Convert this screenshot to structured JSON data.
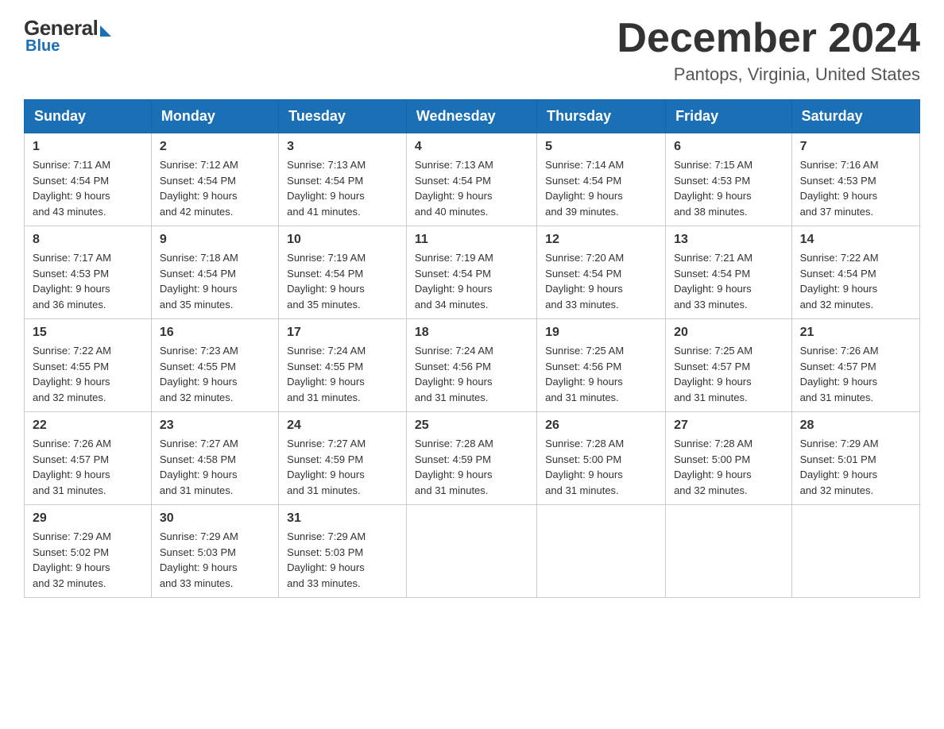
{
  "header": {
    "logo_general": "General",
    "logo_blue": "Blue",
    "month_title": "December 2024",
    "location": "Pantops, Virginia, United States"
  },
  "days_of_week": [
    "Sunday",
    "Monday",
    "Tuesday",
    "Wednesday",
    "Thursday",
    "Friday",
    "Saturday"
  ],
  "weeks": [
    [
      {
        "day": "1",
        "sunrise": "7:11 AM",
        "sunset": "4:54 PM",
        "daylight": "9 hours and 43 minutes."
      },
      {
        "day": "2",
        "sunrise": "7:12 AM",
        "sunset": "4:54 PM",
        "daylight": "9 hours and 42 minutes."
      },
      {
        "day": "3",
        "sunrise": "7:13 AM",
        "sunset": "4:54 PM",
        "daylight": "9 hours and 41 minutes."
      },
      {
        "day": "4",
        "sunrise": "7:13 AM",
        "sunset": "4:54 PM",
        "daylight": "9 hours and 40 minutes."
      },
      {
        "day": "5",
        "sunrise": "7:14 AM",
        "sunset": "4:54 PM",
        "daylight": "9 hours and 39 minutes."
      },
      {
        "day": "6",
        "sunrise": "7:15 AM",
        "sunset": "4:53 PM",
        "daylight": "9 hours and 38 minutes."
      },
      {
        "day": "7",
        "sunrise": "7:16 AM",
        "sunset": "4:53 PM",
        "daylight": "9 hours and 37 minutes."
      }
    ],
    [
      {
        "day": "8",
        "sunrise": "7:17 AM",
        "sunset": "4:53 PM",
        "daylight": "9 hours and 36 minutes."
      },
      {
        "day": "9",
        "sunrise": "7:18 AM",
        "sunset": "4:54 PM",
        "daylight": "9 hours and 35 minutes."
      },
      {
        "day": "10",
        "sunrise": "7:19 AM",
        "sunset": "4:54 PM",
        "daylight": "9 hours and 35 minutes."
      },
      {
        "day": "11",
        "sunrise": "7:19 AM",
        "sunset": "4:54 PM",
        "daylight": "9 hours and 34 minutes."
      },
      {
        "day": "12",
        "sunrise": "7:20 AM",
        "sunset": "4:54 PM",
        "daylight": "9 hours and 33 minutes."
      },
      {
        "day": "13",
        "sunrise": "7:21 AM",
        "sunset": "4:54 PM",
        "daylight": "9 hours and 33 minutes."
      },
      {
        "day": "14",
        "sunrise": "7:22 AM",
        "sunset": "4:54 PM",
        "daylight": "9 hours and 32 minutes."
      }
    ],
    [
      {
        "day": "15",
        "sunrise": "7:22 AM",
        "sunset": "4:55 PM",
        "daylight": "9 hours and 32 minutes."
      },
      {
        "day": "16",
        "sunrise": "7:23 AM",
        "sunset": "4:55 PM",
        "daylight": "9 hours and 32 minutes."
      },
      {
        "day": "17",
        "sunrise": "7:24 AM",
        "sunset": "4:55 PM",
        "daylight": "9 hours and 31 minutes."
      },
      {
        "day": "18",
        "sunrise": "7:24 AM",
        "sunset": "4:56 PM",
        "daylight": "9 hours and 31 minutes."
      },
      {
        "day": "19",
        "sunrise": "7:25 AM",
        "sunset": "4:56 PM",
        "daylight": "9 hours and 31 minutes."
      },
      {
        "day": "20",
        "sunrise": "7:25 AM",
        "sunset": "4:57 PM",
        "daylight": "9 hours and 31 minutes."
      },
      {
        "day": "21",
        "sunrise": "7:26 AM",
        "sunset": "4:57 PM",
        "daylight": "9 hours and 31 minutes."
      }
    ],
    [
      {
        "day": "22",
        "sunrise": "7:26 AM",
        "sunset": "4:57 PM",
        "daylight": "9 hours and 31 minutes."
      },
      {
        "day": "23",
        "sunrise": "7:27 AM",
        "sunset": "4:58 PM",
        "daylight": "9 hours and 31 minutes."
      },
      {
        "day": "24",
        "sunrise": "7:27 AM",
        "sunset": "4:59 PM",
        "daylight": "9 hours and 31 minutes."
      },
      {
        "day": "25",
        "sunrise": "7:28 AM",
        "sunset": "4:59 PM",
        "daylight": "9 hours and 31 minutes."
      },
      {
        "day": "26",
        "sunrise": "7:28 AM",
        "sunset": "5:00 PM",
        "daylight": "9 hours and 31 minutes."
      },
      {
        "day": "27",
        "sunrise": "7:28 AM",
        "sunset": "5:00 PM",
        "daylight": "9 hours and 32 minutes."
      },
      {
        "day": "28",
        "sunrise": "7:29 AM",
        "sunset": "5:01 PM",
        "daylight": "9 hours and 32 minutes."
      }
    ],
    [
      {
        "day": "29",
        "sunrise": "7:29 AM",
        "sunset": "5:02 PM",
        "daylight": "9 hours and 32 minutes."
      },
      {
        "day": "30",
        "sunrise": "7:29 AM",
        "sunset": "5:03 PM",
        "daylight": "9 hours and 33 minutes."
      },
      {
        "day": "31",
        "sunrise": "7:29 AM",
        "sunset": "5:03 PM",
        "daylight": "9 hours and 33 minutes."
      },
      null,
      null,
      null,
      null
    ]
  ],
  "sunrise_label": "Sunrise:",
  "sunset_label": "Sunset:",
  "daylight_label": "Daylight:"
}
